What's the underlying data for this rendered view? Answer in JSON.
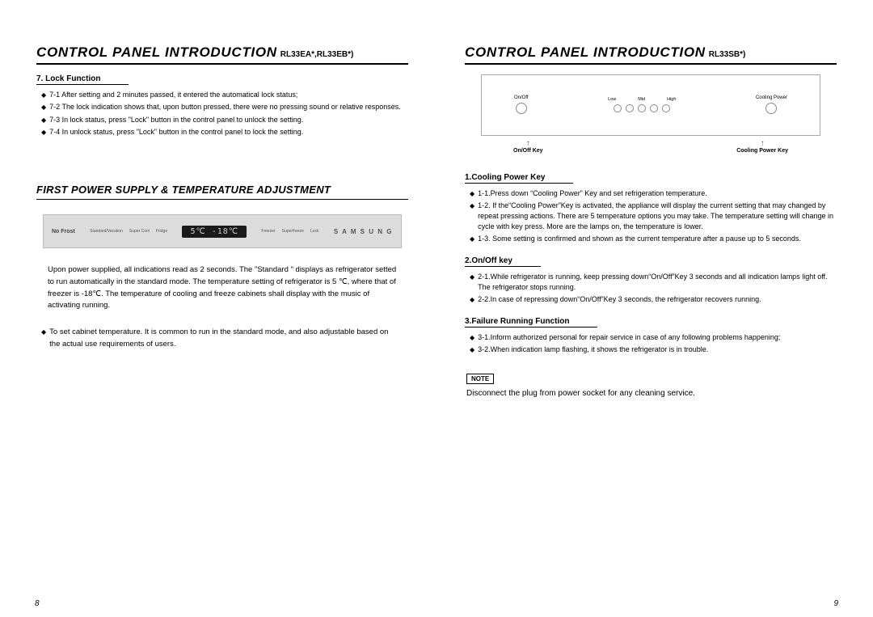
{
  "left": {
    "title": "CONTROL PANEL INTRODUCTION",
    "model": "RL33EA*,RL33EB*)",
    "lock_heading": "7. Lock Function",
    "lock_items": [
      "7-1 After setting and 2 minutes passed, it entered the automatical lock status;",
      "7-2 The lock indication shows that, upon button pressed, there were no pressing sound or relative responses.",
      "7-3 In lock status, press \"Lock\" button in the control panel to unlock the setting.",
      "7-4 In unlock status, press \"Lock\" button in the control panel to lock the setting."
    ],
    "section_title": "FIRST POWER SUPPLY & TEMPERATURE ADJUSTMENT",
    "panel": {
      "nofrost": "No Frost",
      "labels_left": [
        "Standard/Vacation",
        "Super Cool",
        "Fridge"
      ],
      "display": "5℃  -18℃",
      "labels_right": [
        "Freezer",
        "Superfreeze",
        "Lock"
      ],
      "brand": "S A M S U N G"
    },
    "para1": "Upon power supplied, all indications read as 2 seconds. The \"Standard \" displays as refrigerator setted to run automatically in the standard  mode. The temperature setting of refrigerator  is 5 ℃, where that of freezer is -18℃. The temperature of cooling and freeze cabinets shall  display with  the music of activating running.",
    "para2": "To set cabinet temperature. It is common to run in the standard mode, and also adjustable based on the actual use requirements of users.",
    "page": "8"
  },
  "right": {
    "title": "CONTROL PANEL INTRODUCTION",
    "model": "RL33SB*)",
    "panel": {
      "onoff": "On/Off",
      "scale": [
        "Low",
        "Mid",
        "High"
      ],
      "cooling": "Cooling Power",
      "legend_onoff": "On/Off Key",
      "legend_cooling": "Cooling Power Key"
    },
    "s1_heading": "1.Cooling Power Key",
    "s1_items": [
      "1-1.Press down “Cooling Power” Key and set refrigeration temperature.",
      "1-2. If the“Cooling Power”Key is activated, the appliance will display the current setting that may changed by repeat pressing actions. There are 5 temperature options you may take. The temperature setting will change in cycle with key press. More are the lamps on, the temperature is lower.",
      "1-3. Some setting is confirmed and shown as the current temperature after a pause up to 5 seconds."
    ],
    "s2_heading": "2.On/Off key",
    "s2_items": [
      "2-1.While refrigerator is running, keep pressing down“On/Off”Key 3 seconds and all indication  lamps light off. The refrigerator stops running.",
      "2-2.In case of repressing down“On/Off”Key 3 seconds, the refrigerator recovers running."
    ],
    "s3_heading": "3.Failure Running Function",
    "s3_items": [
      "3-1.Inform authorized personal for repair service in case of any following problems happening;",
      "3-2.When indication lamp flashing, it shows the refrigerator is in trouble."
    ],
    "note_label": "NOTE",
    "note_text": "Disconnect the plug from power socket for any cleaning service.",
    "page": "9"
  }
}
